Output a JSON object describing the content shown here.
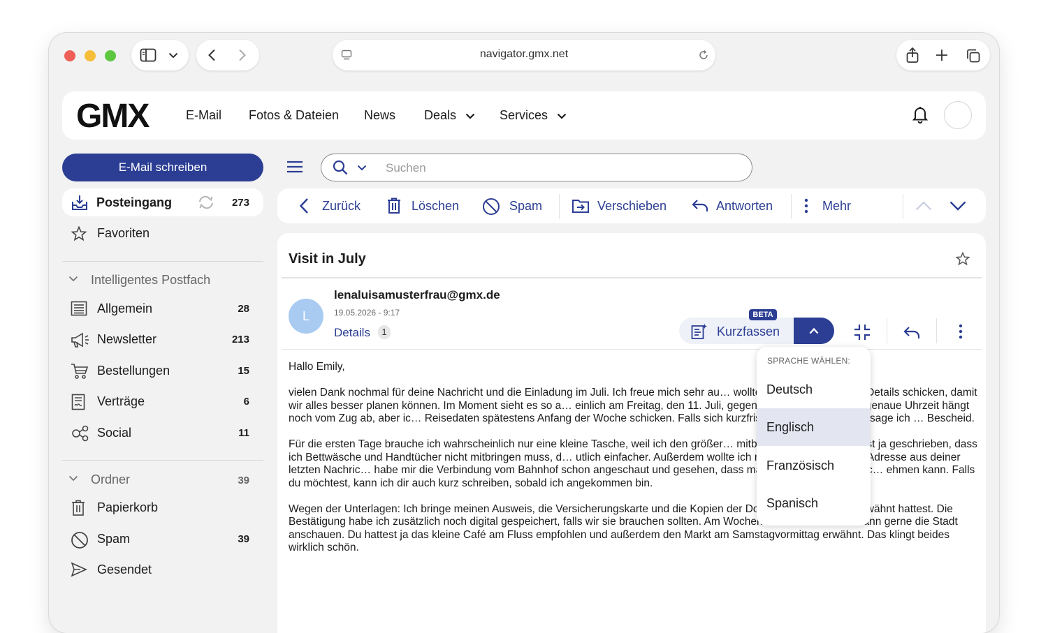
{
  "browser": {
    "url": "navigator.gmx.net"
  },
  "header": {
    "logo": "GMX",
    "nav": [
      "E-Mail",
      "Fotos & Dateien",
      "News",
      "Deals",
      "Services"
    ]
  },
  "sidebar": {
    "compose_label": "E-Mail schreiben",
    "inbox": {
      "label": "Posteingang",
      "count": "273"
    },
    "favorites": {
      "label": "Favoriten"
    },
    "smart_section": "Intelligentes Postfach",
    "smart_items": [
      {
        "label": "Allgemein",
        "count": "28",
        "icon": "list-icon"
      },
      {
        "label": "Newsletter",
        "count": "213",
        "icon": "megaphone-icon"
      },
      {
        "label": "Bestellungen",
        "count": "15",
        "icon": "cart-icon"
      },
      {
        "label": "Verträge",
        "count": "6",
        "icon": "contract-icon"
      },
      {
        "label": "Social",
        "count": "11",
        "icon": "social-icon"
      }
    ],
    "folders_section": {
      "label": "Ordner",
      "count": "39"
    },
    "folders": [
      {
        "label": "Papierkorb",
        "count": "",
        "icon": "trash-icon"
      },
      {
        "label": "Spam",
        "count": "39",
        "icon": "spam-icon"
      },
      {
        "label": "Gesendet",
        "count": "",
        "icon": "send-icon"
      }
    ]
  },
  "search": {
    "placeholder": "Suchen"
  },
  "toolbar": {
    "back": "Zurück",
    "delete": "Löschen",
    "spam": "Spam",
    "move": "Verschieben",
    "reply": "Antworten",
    "more": "Mehr"
  },
  "mail": {
    "subject": "Visit in July",
    "avatar_initial": "L",
    "sender": "lenaluisamusterfrau@gmx.de",
    "date": "19.05.2026 - 9:17",
    "details_label": "Details",
    "details_count": "1",
    "summarize_label": "Kurzfassen",
    "beta_label": "BETA",
    "body": [
      "Hallo Emily,",
      "vielen Dank nochmal für deine Nachricht und die Einladung im Juli. Ich freue mich sehr au… wollte dir kurz die aktuellen Details schicken, damit wir alles besser planen können. Im Moment sieht es so a… einlich am Freitag, den 11. Juli, gegen Mittag ankomme. Die genaue Uhrzeit hängt noch vom Zug ab, aber ic… Reisedaten spätestens Anfang der Woche schicken. Falls sich kurzfristig noch etwas ändert, sage ich … Bescheid.",
      "Für die ersten Tage brauche ich wahrscheinlich nur eine kleine Tasche, weil ich den größer… mitbringen werde. Du hattest ja geschrieben, dass ich Bettwäsche und Handtücher nicht mitbringen muss, d… utlich einfacher. Außerdem wollte ich nochmal fragen, ob die Adresse aus deiner letzten Nachric… habe mir die Verbindung vom Bahnhof schon angeschaut und gesehen, dass man entweder den Bus oc… ehmen kann. Falls du möchtest, kann ich dir auch kurz schreiben, sobald ich angekommen bin.",
      "Wegen der Unterlagen: Ich bringe meinen Ausweis, die Versicherungskarte und die Kopien der Dokumente mit, die du erwähnt hattest. Die Bestätigung habe ich zusätzlich noch digital gespeichert, falls wir sie brauchen sollten. Am Wochenende würde ich mir dann gerne die Stadt anschauen. Du hattest ja das kleine Café am Fluss empfohlen und außerdem den Markt am Samstagvormittag erwähnt. Das klingt beides wirklich schön."
    ]
  },
  "language_menu": {
    "title": "SPRACHE WÄHLEN:",
    "options": [
      "Deutsch",
      "Englisch",
      "Französisch",
      "Spanisch"
    ],
    "selected": "Englisch"
  }
}
